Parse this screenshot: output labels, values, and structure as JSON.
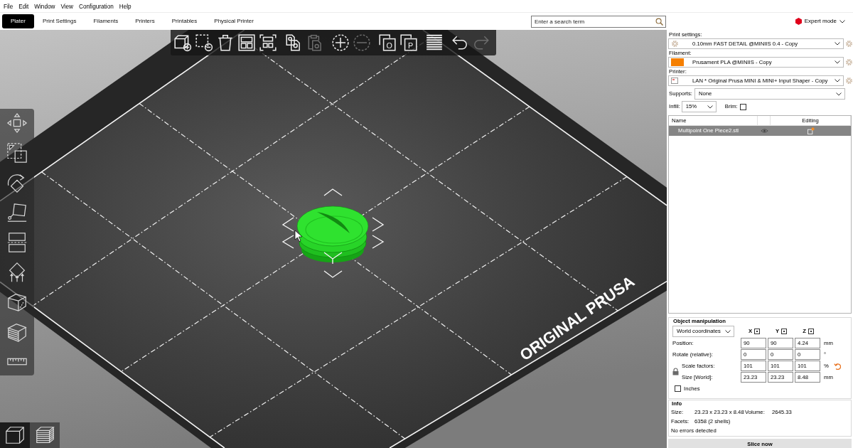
{
  "menu": [
    "File",
    "Edit",
    "Window",
    "View",
    "Configuration",
    "Help"
  ],
  "tabs": [
    {
      "label": "Plater",
      "selected": true
    },
    {
      "label": "Print Settings",
      "selected": false
    },
    {
      "label": "Filaments",
      "selected": false
    },
    {
      "label": "Printers",
      "selected": false
    },
    {
      "label": "Printables",
      "selected": false
    },
    {
      "label": "Physical Printer",
      "selected": false
    }
  ],
  "search": {
    "placeholder": "Enter a search term"
  },
  "mode": {
    "label": "Expert mode",
    "color": "#e0001b"
  },
  "toolbar": [
    {
      "kind": "add",
      "disabled": false
    },
    {
      "kind": "delete",
      "disabled": false
    },
    {
      "kind": "delete_all",
      "disabled": false
    },
    {
      "kind": "arrange",
      "disabled": false
    },
    {
      "kind": "arrange_selection",
      "disabled": false
    },
    {
      "kind": "copy",
      "disabled": false
    },
    {
      "kind": "paste",
      "disabled": true
    },
    {
      "kind": "add_instance",
      "disabled": false
    },
    {
      "kind": "remove_instance",
      "disabled": true
    },
    {
      "kind": "split_objects",
      "disabled": false,
      "glyph": "O"
    },
    {
      "kind": "split_parts",
      "disabled": false,
      "glyph": "P"
    },
    {
      "kind": "layers",
      "disabled": false
    },
    {
      "kind": "undo",
      "disabled": false
    },
    {
      "kind": "redo",
      "disabled": true
    }
  ],
  "tools": [
    {
      "kind": "move"
    },
    {
      "kind": "scale"
    },
    {
      "kind": "rotate"
    },
    {
      "kind": "place"
    },
    {
      "kind": "cut"
    },
    {
      "kind": "supports"
    },
    {
      "kind": "seam"
    },
    {
      "kind": "variable_layer"
    },
    {
      "kind": "measure"
    }
  ],
  "views": [
    {
      "kind": "editor",
      "selected": true
    },
    {
      "kind": "preview",
      "selected": false
    }
  ],
  "scene": {
    "bed_label": "ORIGINAL PRUSA",
    "object": {
      "selected": true
    }
  },
  "sidebar": {
    "presets": [
      {
        "kind": "print",
        "label": "Print settings:",
        "value": "0.10mm FAST DETAIL @MINIIS 0.4 - Copy"
      },
      {
        "kind": "filament",
        "label": "Filament:",
        "value": "Prusament PLA @MINIIS - Copy",
        "color": "#f57f00"
      },
      {
        "kind": "printer",
        "label": "Printer:",
        "value": "LAN * Original Prusa MINI & MINI+ Input Shaper - Copy"
      }
    ],
    "supports": {
      "label": "Supports:",
      "value": "None"
    },
    "infill": {
      "label": "Infill:",
      "value": "15%"
    },
    "brim": {
      "label": "Brim:",
      "checked": false
    },
    "object_list": {
      "columns": [
        "Name",
        "Editing"
      ],
      "rows": [
        {
          "name": "Multipoint One Piece2.stl",
          "selected": true
        }
      ]
    },
    "manipulation": {
      "title": "Object manipulation",
      "coordinates": "World coordinates",
      "axes": [
        "X",
        "Y",
        "Z"
      ],
      "rows": [
        {
          "kind": "position",
          "label": "Position:",
          "values": [
            "90",
            "90",
            "4.24"
          ],
          "unit": "mm"
        },
        {
          "kind": "rotate",
          "label": "Rotate (relative):",
          "values": [
            "0",
            "0",
            "0"
          ],
          "unit": "°"
        },
        {
          "kind": "scale",
          "label": "Scale factors:",
          "values": [
            "101",
            "101",
            "101"
          ],
          "unit": "%"
        },
        {
          "kind": "size",
          "label": "Size [World]:",
          "values": [
            "23.23",
            "23.23",
            "8.48"
          ],
          "unit": "mm"
        }
      ],
      "inches": {
        "label": "Inches",
        "checked": false
      }
    },
    "info": {
      "title": "Info",
      "size_label": "Size:",
      "size": "23.23 x 23.23 x 8.48",
      "volume_label": "Volume:",
      "volume": "2645.33",
      "facets_label": "Facets:",
      "facets": "6358 (2 shells)",
      "status": "No errors detected"
    },
    "slice_button": "Slice now"
  }
}
